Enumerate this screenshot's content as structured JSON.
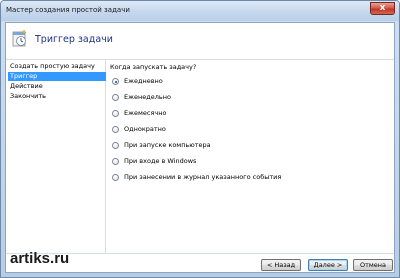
{
  "window": {
    "title": "Мастер создания простой задачи",
    "close_label": "x"
  },
  "header": {
    "title": "Триггер задачи",
    "icon": "task-scheduler-icon"
  },
  "sidebar": {
    "items": [
      {
        "label": "Создать простую задачу",
        "active": false
      },
      {
        "label": "Триггер",
        "active": true
      },
      {
        "label": "Действие",
        "active": false
      },
      {
        "label": "Закончить",
        "active": false
      }
    ]
  },
  "main": {
    "question": "Когда запускать задачу?",
    "options": [
      {
        "label": "Ежедневно",
        "checked": true
      },
      {
        "label": "Еженедельно",
        "checked": false
      },
      {
        "label": "Ежемесячно",
        "checked": false
      },
      {
        "label": "Однократно",
        "checked": false
      },
      {
        "label": "При запуске компьютера",
        "checked": false
      },
      {
        "label": "При входе в Windows",
        "checked": false
      },
      {
        "label": "При занесении в журнал указанного события",
        "checked": false
      }
    ]
  },
  "footer": {
    "back_label": "< Назад",
    "next_label": "Далее >",
    "cancel_label": "Отмена"
  },
  "watermark": "artiks.ru"
}
